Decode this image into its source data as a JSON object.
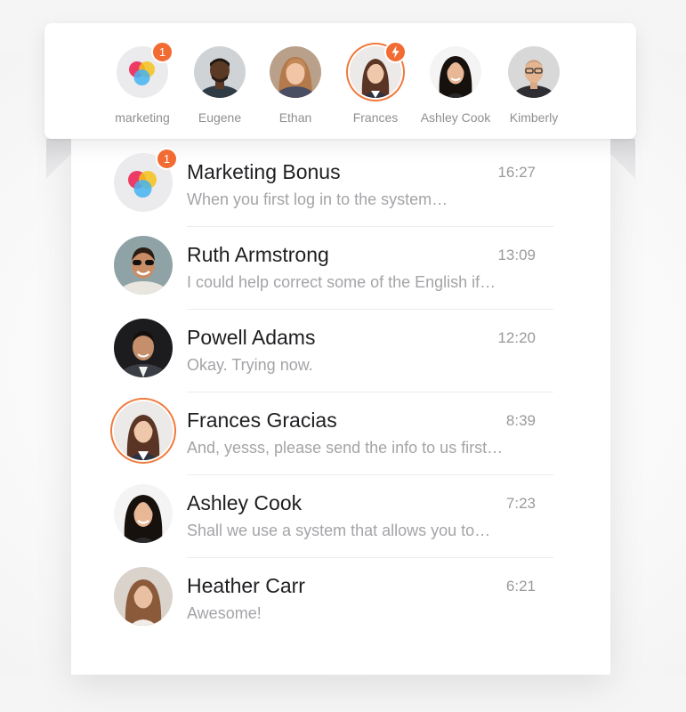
{
  "contacts": [
    {
      "name": "marketing",
      "badge": "1",
      "type": "logo"
    },
    {
      "name": "Eugene"
    },
    {
      "name": "Ethan"
    },
    {
      "name": "Frances",
      "badge_icon": "lightning-icon",
      "active": true
    },
    {
      "name": "Ashley Cook"
    },
    {
      "name": "Kimberly"
    }
  ],
  "chats": [
    {
      "name": "Marketing Bonus",
      "time": "16:27",
      "preview": "When you first log in to the system…",
      "badge": "1"
    },
    {
      "name": "Ruth Armstrong",
      "time": "13:09",
      "preview": "I could help correct some of the English if…"
    },
    {
      "name": "Powell Adams",
      "time": "12:20",
      "preview": "Okay. Trying now."
    },
    {
      "name": "Frances Gracias",
      "time": "8:39",
      "preview": "And, yesss, please send the info to us first…"
    },
    {
      "name": "Ashley Cook",
      "time": "7:23",
      "preview": "Shall we use a system that allows you to…"
    },
    {
      "name": "Heather Carr",
      "time": "6:21",
      "preview": "Awesome!"
    }
  ],
  "colors": {
    "accent": "#f26b32",
    "ring": "#f07a3c",
    "name_text": "#1f1f22",
    "muted_text": "#a4a4a8"
  }
}
